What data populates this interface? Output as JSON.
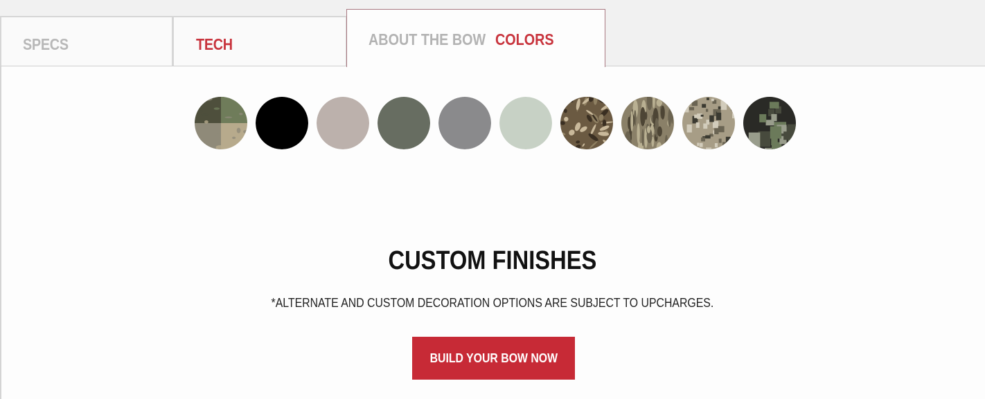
{
  "tabs": {
    "specs_label": "SPECS",
    "tech_label": "TECH",
    "about_label": "ABOUT THE BOW",
    "colors_label": "COLORS"
  },
  "swatches": [
    {
      "name": "multi-finish",
      "kind": "pattern",
      "colors": [
        "#6f7c5a",
        "#8f8a79",
        "#b7aa8c",
        "#4e4f3c"
      ]
    },
    {
      "name": "black",
      "kind": "solid",
      "color": "#000000"
    },
    {
      "name": "taupe",
      "kind": "solid",
      "color": "#bcb1ac"
    },
    {
      "name": "olive-gray",
      "kind": "solid",
      "color": "#676d61"
    },
    {
      "name": "gray",
      "kind": "solid",
      "color": "#8a8a8c"
    },
    {
      "name": "sage",
      "kind": "solid",
      "color": "#c7d1c5"
    },
    {
      "name": "realtree-camo",
      "kind": "pattern",
      "colors": [
        "#6b5a42",
        "#c9b99b",
        "#3a2f22",
        "#8f8062"
      ]
    },
    {
      "name": "bottomland-camo",
      "kind": "pattern",
      "colors": [
        "#8a8068",
        "#4d4535",
        "#b9b092",
        "#6b6350"
      ]
    },
    {
      "name": "digital-camo",
      "kind": "pattern",
      "colors": [
        "#a79d86",
        "#6a6453",
        "#3b3a31",
        "#d2ccbb"
      ]
    },
    {
      "name": "kuiu-camo",
      "kind": "pattern",
      "colors": [
        "#2a2a26",
        "#6b7a5a",
        "#999d8c",
        "#474a3d"
      ]
    }
  ],
  "main": {
    "heading": "CUSTOM FINISHES",
    "note": "*ALTERNATE AND CUSTOM DECORATION OPTIONS ARE SUBJECT TO UPCHARGES.",
    "cta_label": "BUILD YOUR BOW NOW"
  },
  "theme": {
    "accent": "#c72a36",
    "tab_inactive_text": "#b8b8b8"
  }
}
